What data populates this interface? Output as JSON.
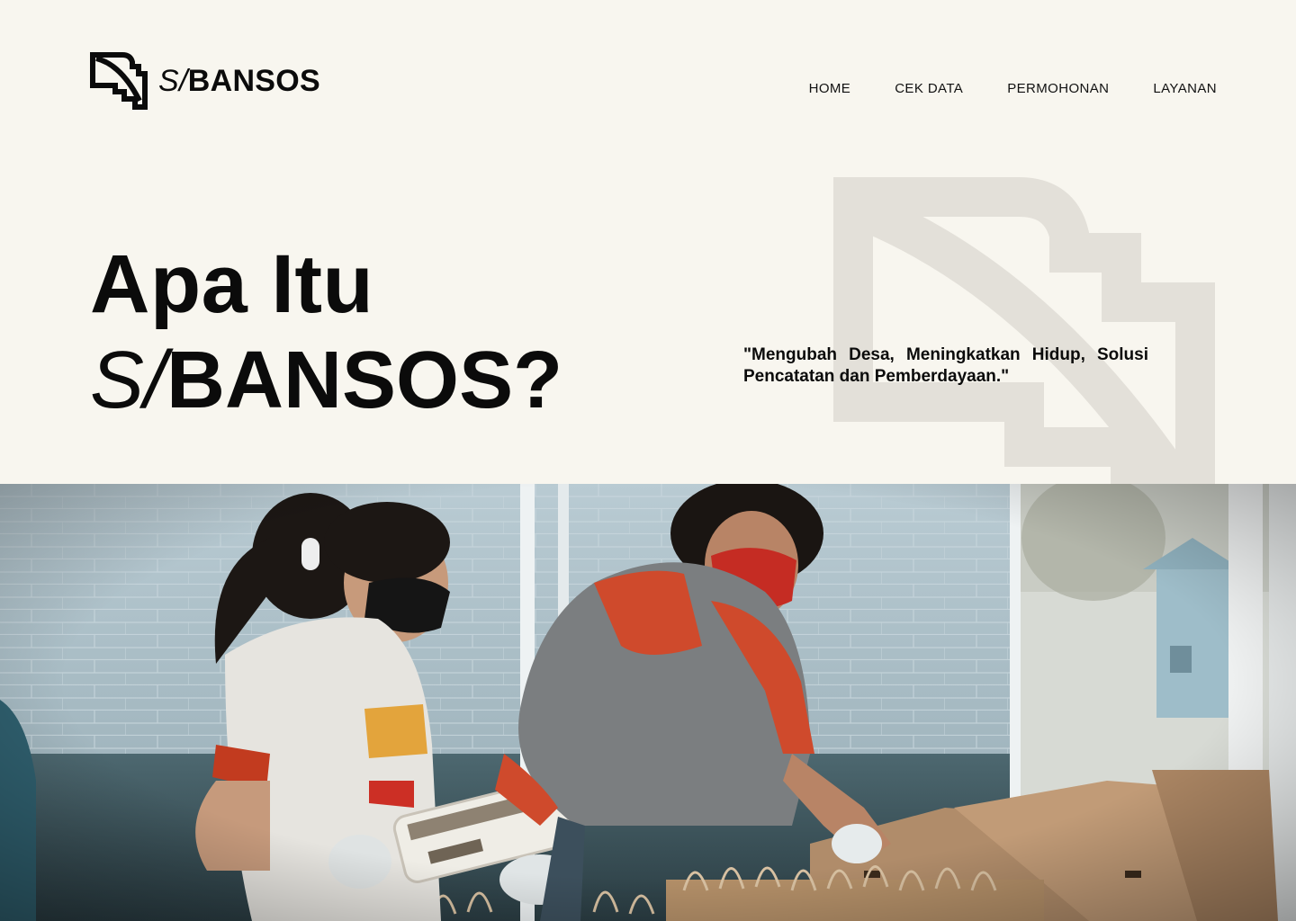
{
  "brand": {
    "logo_prefix": "S/",
    "logo_suffix": "BANSOS",
    "logo_icon": "sibansos-logo-icon"
  },
  "nav": {
    "items": [
      {
        "label": "HOME"
      },
      {
        "label": "CEK DATA"
      },
      {
        "label": "PERMOHONAN"
      },
      {
        "label": "LAYANAN"
      }
    ]
  },
  "hero": {
    "title_line1": "Apa Itu",
    "title_prefix": "S/",
    "title_suffix": "BANSOS?",
    "quote": "\"Mengubah Desa, Meningkatkan Hidup, Solusi Pencatatan dan Pemberdayaan.\""
  },
  "colors": {
    "background": "#f8f6ef",
    "text": "#0b0b0b",
    "watermark": "#e3e0d9"
  }
}
